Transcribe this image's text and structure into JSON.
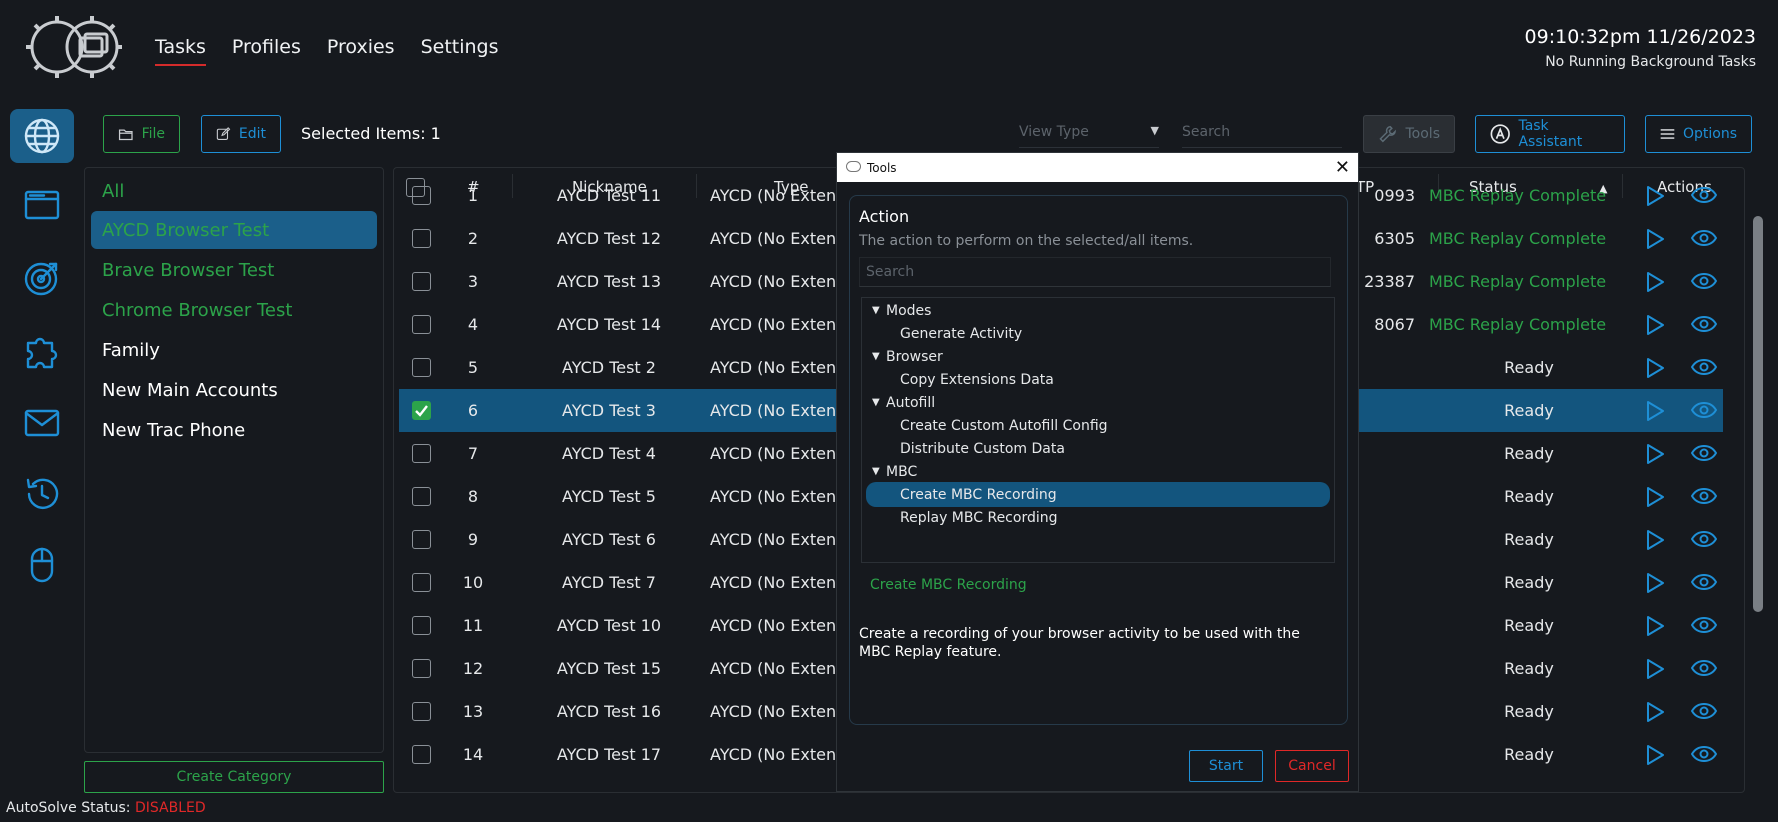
{
  "nav": {
    "tabs": [
      "Tasks",
      "Profiles",
      "Proxies",
      "Settings"
    ],
    "active_tab": "Tasks",
    "datetime": "09:10:32pm 11/26/2023",
    "background_status": "No Running Background Tasks"
  },
  "rail_icons": [
    "globe-icon",
    "browser-window-icon",
    "target-icon",
    "puzzle-icon",
    "mail-icon",
    "history-icon",
    "mouse-icon"
  ],
  "toolbar": {
    "file_label": "File",
    "edit_label": "Edit",
    "selected_items": "Selected Items: 1",
    "view_type_placeholder": "View Type",
    "search_placeholder": "Search",
    "tools_label": "Tools",
    "task_assistant_label": "Task Assistant",
    "options_label": "Options"
  },
  "categories": [
    {
      "label": "All",
      "color": "#2ca34a"
    },
    {
      "label": "AYCD Browser Test",
      "color": "#2ca34a"
    },
    {
      "label": "Brave Browser Test",
      "color": "#2ca34a"
    },
    {
      "label": "Chrome Browser Test",
      "color": "#2ca34a"
    },
    {
      "label": "Family",
      "color": "#ffffff"
    },
    {
      "label": "New Main Accounts",
      "color": "#ffffff"
    },
    {
      "label": "New Trac Phone",
      "color": "#ffffff"
    }
  ],
  "selected_category": "AYCD Browser Test",
  "create_category_label": "Create Category",
  "autosolve": {
    "label": "AutoSolve Status:",
    "value": "DISABLED"
  },
  "table": {
    "headers": {
      "num": "#",
      "nickname": "Nickname",
      "type": "Type",
      "partial": "TP",
      "status": "Status",
      "actions": "Actions"
    },
    "rows": [
      {
        "num": "1",
        "nickname": "AYCD Test 11",
        "type": "AYCD (No Extens",
        "partial": "0993",
        "status": "MBC Replay Complete",
        "checked": false
      },
      {
        "num": "2",
        "nickname": "AYCD Test 12",
        "type": "AYCD (No Extens",
        "partial": "6305",
        "status": "MBC Replay Complete",
        "checked": false
      },
      {
        "num": "3",
        "nickname": "AYCD Test 13",
        "type": "AYCD (No Extens",
        "partial": "23387",
        "status": "MBC Replay Complete",
        "checked": false
      },
      {
        "num": "4",
        "nickname": "AYCD Test 14",
        "type": "AYCD (No Extens",
        "partial": "8067",
        "status": "MBC Replay Complete",
        "checked": false
      },
      {
        "num": "5",
        "nickname": "AYCD Test 2",
        "type": "AYCD (No Extens",
        "partial": "",
        "status": "Ready",
        "checked": false
      },
      {
        "num": "6",
        "nickname": "AYCD Test 3",
        "type": "AYCD (No Extens",
        "partial": "",
        "status": "Ready",
        "checked": true
      },
      {
        "num": "7",
        "nickname": "AYCD Test 4",
        "type": "AYCD (No Extens",
        "partial": "",
        "status": "Ready",
        "checked": false
      },
      {
        "num": "8",
        "nickname": "AYCD Test 5",
        "type": "AYCD (No Extens",
        "partial": "",
        "status": "Ready",
        "checked": false
      },
      {
        "num": "9",
        "nickname": "AYCD Test 6",
        "type": "AYCD (No Extens",
        "partial": "",
        "status": "Ready",
        "checked": false
      },
      {
        "num": "10",
        "nickname": "AYCD Test 7",
        "type": "AYCD (No Extens",
        "partial": "",
        "status": "Ready",
        "checked": false
      },
      {
        "num": "11",
        "nickname": "AYCD Test 10",
        "type": "AYCD (No Extens",
        "partial": "",
        "status": "Ready",
        "checked": false
      },
      {
        "num": "12",
        "nickname": "AYCD Test 15",
        "type": "AYCD (No Extens",
        "partial": "",
        "status": "Ready",
        "checked": false
      },
      {
        "num": "13",
        "nickname": "AYCD Test 16",
        "type": "AYCD (No Extens",
        "partial": "",
        "status": "Ready",
        "checked": false
      },
      {
        "num": "14",
        "nickname": "AYCD Test 17",
        "type": "AYCD (No Extens",
        "partial": "",
        "status": "Ready",
        "checked": false
      }
    ]
  },
  "modal": {
    "title": "Tools",
    "action_label": "Action",
    "action_sub": "The action to perform on the selected/all items.",
    "search_placeholder": "Search",
    "tree": [
      {
        "label": "Modes",
        "group": true
      },
      {
        "label": "Generate Activity",
        "group": false
      },
      {
        "label": "Browser",
        "group": true
      },
      {
        "label": "Copy Extensions Data",
        "group": false
      },
      {
        "label": "Autofill",
        "group": true
      },
      {
        "label": "Create Custom Autofill Config",
        "group": false
      },
      {
        "label": "Distribute Custom Data",
        "group": false
      },
      {
        "label": "MBC",
        "group": true
      },
      {
        "label": "Create MBC Recording",
        "group": false
      },
      {
        "label": "Replay MBC Recording",
        "group": false
      }
    ],
    "selected_action": "Create MBC Recording",
    "description": "Create a recording of your browser activity to be used with the MBC Replay feature.",
    "start_label": "Start",
    "cancel_label": "Cancel"
  },
  "colors": {
    "accent_blue": "#1e8fd6",
    "accent_green": "#2ca34a",
    "danger_red": "#e02828",
    "selection": "#13557e"
  }
}
